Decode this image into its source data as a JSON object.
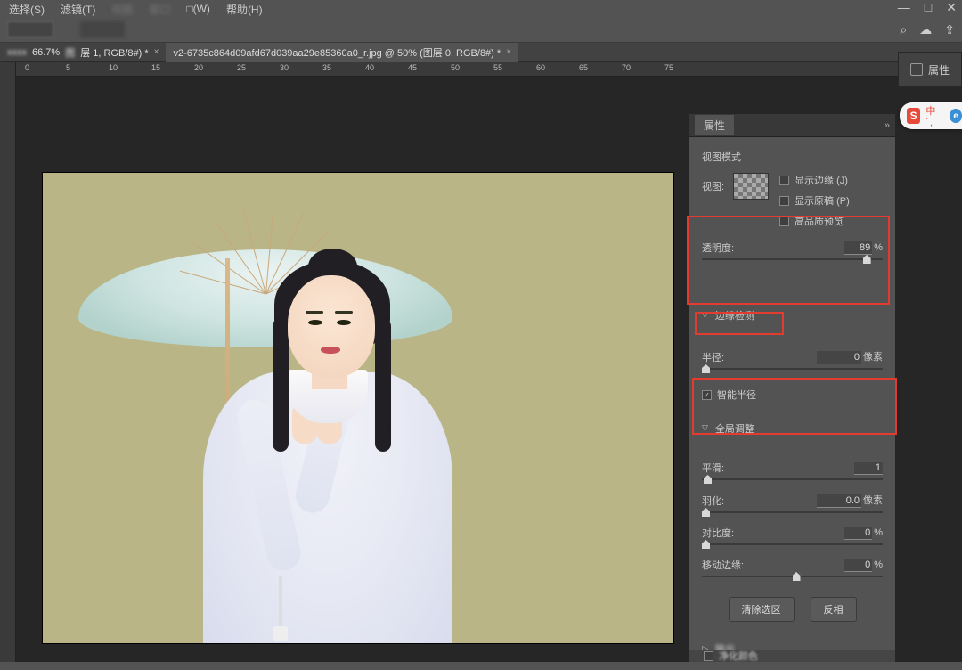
{
  "menu": {
    "select": "选择(S)",
    "filter": "滤镜(T)",
    "blur1": "视图",
    "blur2": "窗口",
    "view": "□(W)",
    "help": "帮助(H)"
  },
  "wincontrols": {
    "min": "—",
    "max": "□",
    "close": "✕"
  },
  "toolbar_right": {
    "search": "⌕",
    "cloud": "☁",
    "share": "⇪"
  },
  "tabs": {
    "t1_zoom": "66.7%",
    "t1_rest": "层 1, RGB/8#) *",
    "t2": "v2-6735c864d09afd67d039aa29e85360a0_r.jpg @ 50% (图层 0, RGB/8#) *"
  },
  "ruler_ticks": [
    "0",
    "5",
    "10",
    "15",
    "20",
    "25",
    "30",
    "35",
    "40",
    "45",
    "50",
    "55",
    "60",
    "65",
    "70",
    "75"
  ],
  "panel": {
    "title": "属性",
    "view_mode": "视图模式",
    "view_label": "视图:",
    "chk_edge": "显示边缘 (J)",
    "chk_orig": "显示原稿 (P)",
    "chk_hq": "高品质预览",
    "opacity_label": "透明度:",
    "opacity_val": "89",
    "opacity_unit": "%",
    "edge_section": "边缘检测",
    "radius_label": "半径:",
    "radius_val": "0",
    "radius_unit": "像素",
    "smart_radius": "智能半径",
    "global_section": "全局调整",
    "smooth_label": "平滑:",
    "smooth_val": "1",
    "feather_label": "羽化:",
    "feather_val": "0.0",
    "feather_unit": "像素",
    "contrast_label": "对比度:",
    "contrast_val": "0",
    "contrast_unit": "%",
    "shift_label": "移动边缘:",
    "shift_val": "0",
    "shift_unit": "%",
    "btn_clear": "清除选区",
    "btn_invert": "反相",
    "output_section": "输出",
    "bottom_chk": "净化颜色"
  },
  "collapsed_panel": "属性",
  "badge": {
    "s": "S",
    "mid": "中 ˙,",
    "e": "e"
  }
}
